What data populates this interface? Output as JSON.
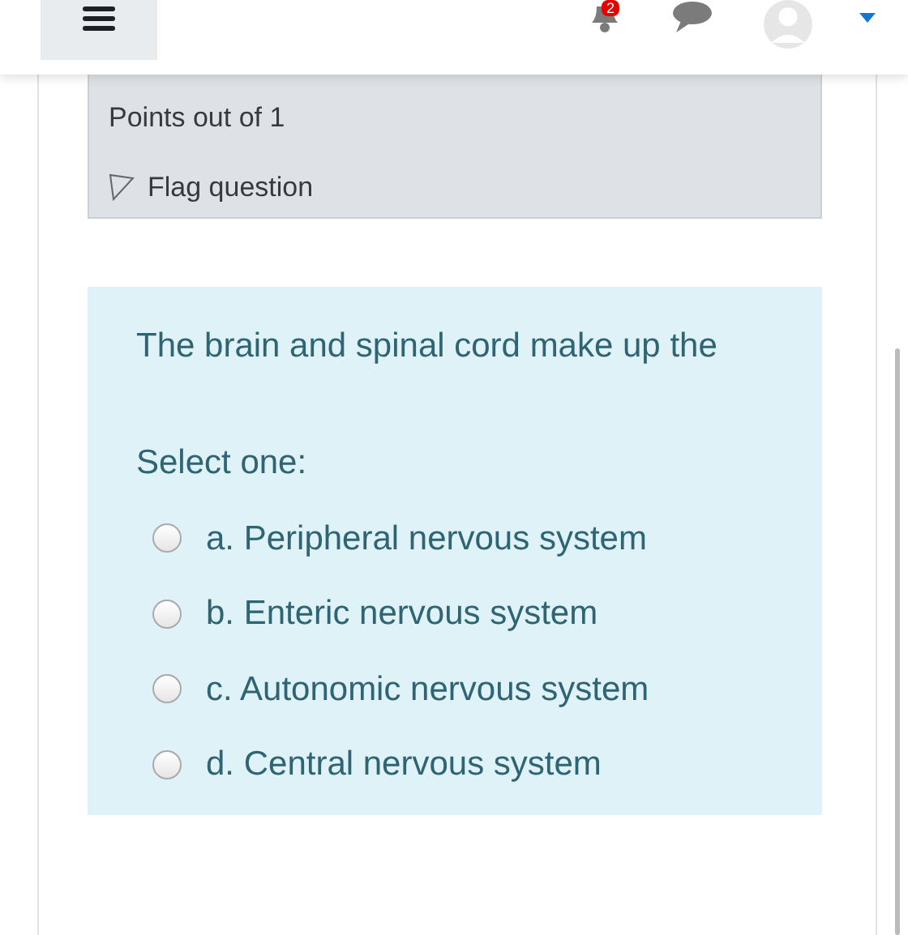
{
  "header": {
    "notification_count": "2"
  },
  "info": {
    "points": "Points out of 1",
    "flag_label": "Flag question",
    "flagged": false
  },
  "question": {
    "text": "The brain and spinal cord make up the",
    "prompt": "Select one:",
    "options": [
      {
        "label": "a. Peripheral nervous system",
        "selected": false
      },
      {
        "label": "b. Enteric nervous system",
        "selected": false
      },
      {
        "label": "c. Autonomic nervous system",
        "selected": false
      },
      {
        "label": "d. Central nervous system",
        "selected": false
      }
    ]
  }
}
